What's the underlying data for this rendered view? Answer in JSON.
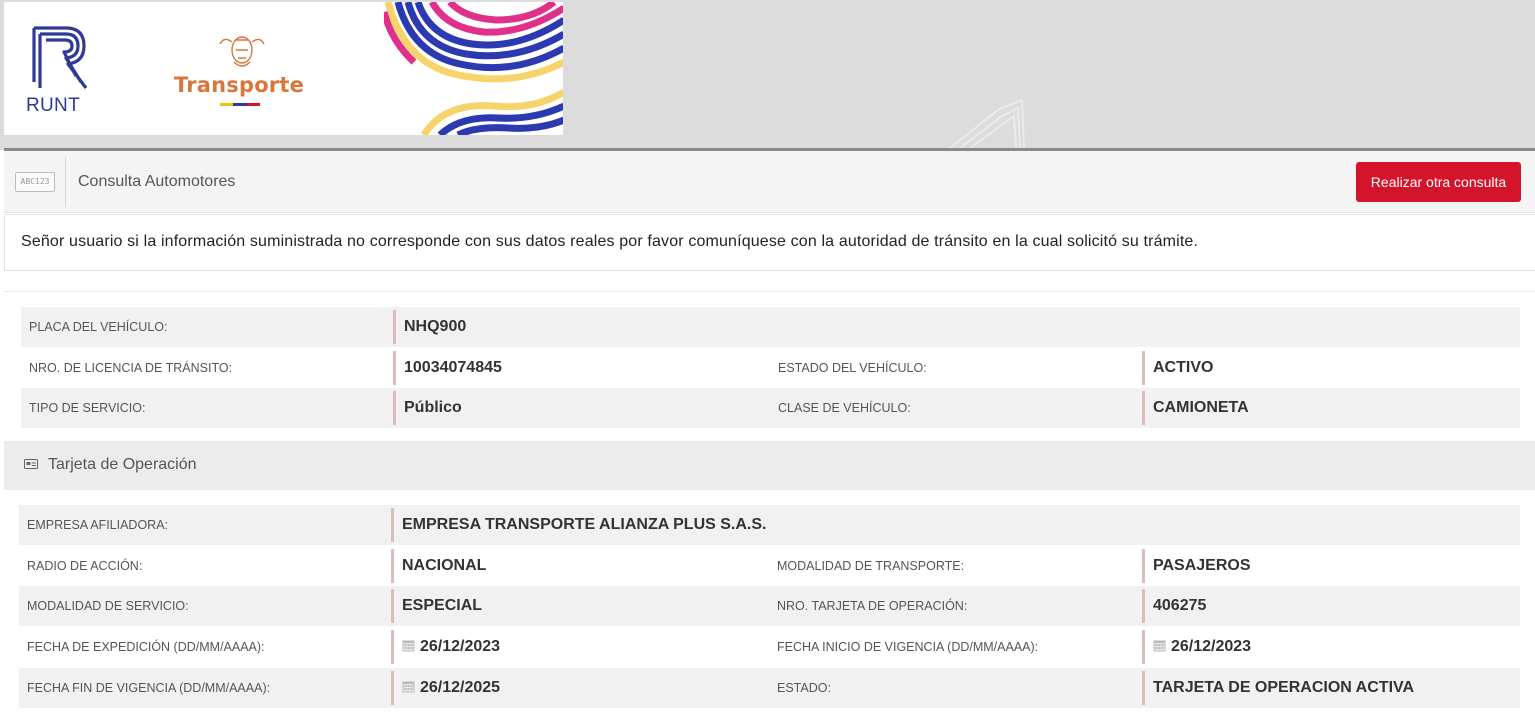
{
  "header": {
    "runt_logo_text": "RUNT",
    "ministry_logo_text": "Transporte",
    "colors": {
      "runt_blue": "#2f3a96",
      "transporte_orange": "#d8763b",
      "flag_yellow": "#f5c400",
      "flag_blue": "#2b3d9a",
      "flag_red": "#d4142b"
    }
  },
  "toolbar": {
    "icon": "license-plate-icon",
    "icon_text": "ABC123",
    "title": "Consulta Automotores",
    "again_button": "Realizar otra consulta",
    "accent_color": "#d4142b"
  },
  "notice": "Señor usuario si la información suministrada no corresponde con sus datos reales por favor comuníquese con la autoridad de tránsito en la cual solicitó su trámite.",
  "vehicle": {
    "plate_label": "PLACA DEL VEHÍCULO:",
    "plate_value": "NHQ900",
    "license_label": "NRO. DE LICENCIA DE TRÁNSITO:",
    "license_value": "10034074845",
    "state_label": "ESTADO DEL VEHÍCULO:",
    "state_value": "ACTIVO",
    "service_label": "TIPO DE SERVICIO:",
    "service_value": "Público",
    "class_label": "CLASE DE VEHÍCULO:",
    "class_value": "CAMIONETA"
  },
  "operation_card": {
    "section_title": "Tarjeta de Operación",
    "section_icon": "card-icon",
    "company_label": "EMPRESA AFILIADORA:",
    "company_value": "EMPRESA TRANSPORTE ALIANZA PLUS S.A.S.",
    "radius_label": "RADIO DE ACCIÓN:",
    "radius_value": "NACIONAL",
    "transport_mode_label": "MODALIDAD DE TRANSPORTE:",
    "transport_mode_value": "PASAJEROS",
    "service_mode_label": "MODALIDAD DE SERVICIO:",
    "service_mode_value": "ESPECIAL",
    "card_number_label": "NRO. TARJETA DE OPERACIÓN:",
    "card_number_value": "406275",
    "issue_date_label": "FECHA DE EXPEDICIÓN (DD/MM/AAAA):",
    "issue_date_value": "26/12/2023",
    "start_date_label": "FECHA INICIO DE VIGENCIA (DD/MM/AAAA):",
    "start_date_value": "26/12/2023",
    "end_date_label": "FECHA FIN DE VIGENCIA (DD/MM/AAAA):",
    "end_date_value": "26/12/2025",
    "status_label": "ESTADO:",
    "status_value": "TARJETA DE OPERACION ACTIVA",
    "date_icon": "calendar-icon"
  }
}
